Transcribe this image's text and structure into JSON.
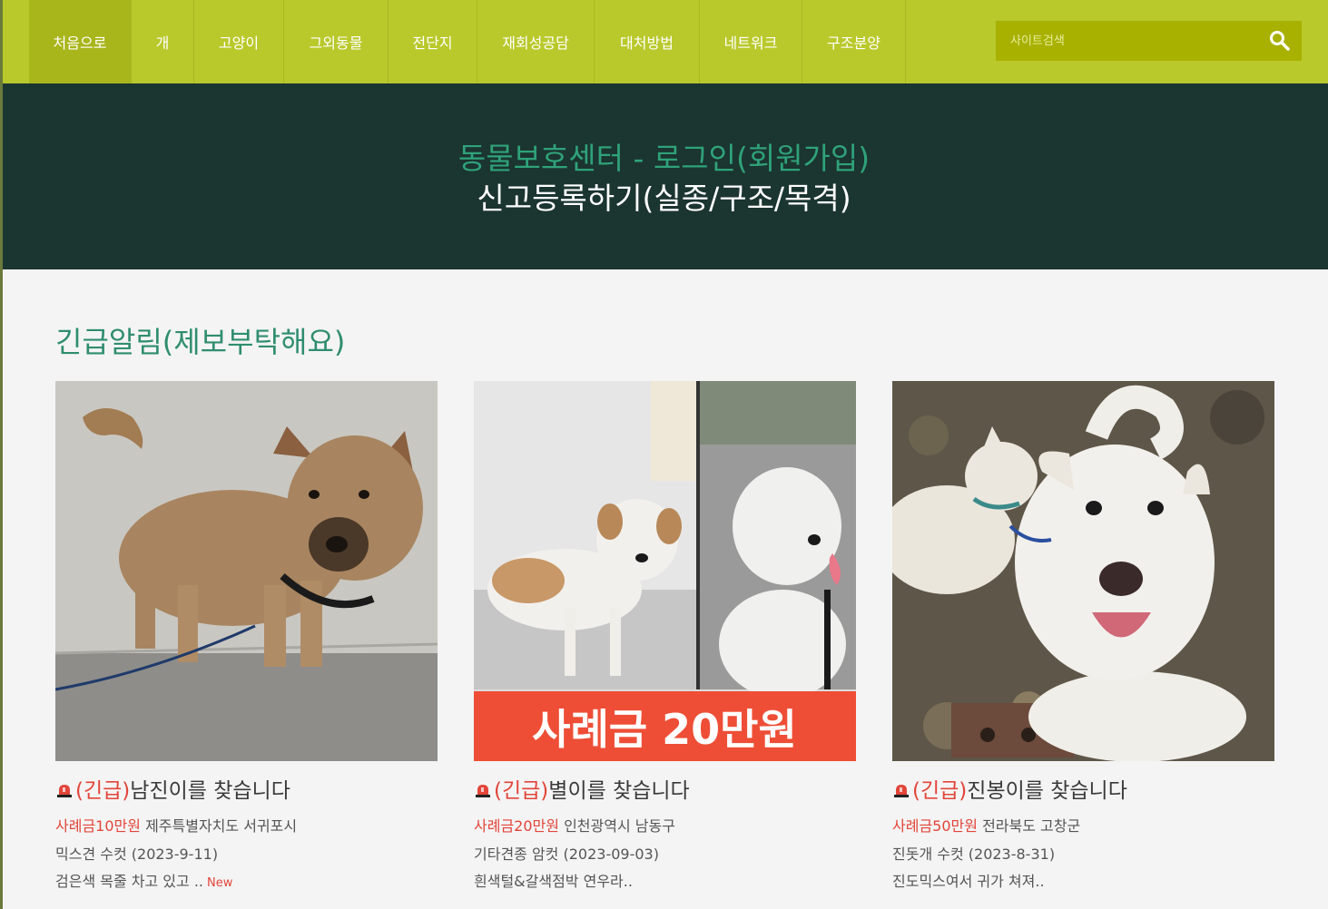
{
  "nav": {
    "items": [
      {
        "label": "처음으로",
        "active": true
      },
      {
        "label": "개"
      },
      {
        "label": "고양이"
      },
      {
        "label": "그외동물"
      },
      {
        "label": "전단지"
      },
      {
        "label": "재회성공담"
      },
      {
        "label": "대처방법"
      },
      {
        "label": "네트워크"
      },
      {
        "label": "구조분양"
      }
    ],
    "search_placeholder": "사이트검색",
    "search_icon": "search-icon"
  },
  "hero": {
    "line1": "동물보호센터 - 로그인(회원가입)",
    "line2": "신고등록하기(실종/구조/목격)"
  },
  "section": {
    "title": "긴급알림(제보부탁해요)"
  },
  "cards": [
    {
      "urgent": "(긴급)",
      "title": "남진이를 찾습니다",
      "reward": "사례금10만원",
      "location": "제주특별자치도 서귀포시",
      "info": "믹스견 수컷 (2023-9-11)",
      "desc": "검은색 목줄 차고 있고 ..",
      "badge": "New"
    },
    {
      "urgent": "(긴급)",
      "title": "별이를 찾습니다",
      "reward": "사례금20만원",
      "location": "인천광역시 남동구",
      "info": "기타견종 암컷 (2023-09-03)",
      "desc": "흰색털&갈색점박 연우라..",
      "banner": "사례금 20만원"
    },
    {
      "urgent": "(긴급)",
      "title": "진봉이를 찾습니다",
      "reward": "사례금50만원",
      "location": "전라북도 고창군",
      "info": "진돗개 수컷 (2023-8-31)",
      "desc": "진도믹스여서 귀가 쳐져.."
    }
  ],
  "colors": {
    "nav_bg": "#b9c92b",
    "hero_bg": "#1b3530",
    "accent_green": "#2f8d6f",
    "urgent_red": "#e2453a"
  }
}
